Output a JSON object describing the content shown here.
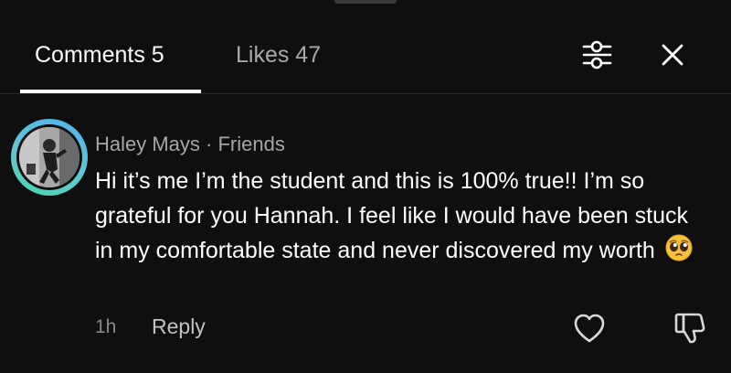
{
  "tabs": {
    "comments_label": "Comments 5",
    "likes_label": "Likes 47"
  },
  "header_icons": {
    "filter": "sliders-icon",
    "close": "close-icon"
  },
  "comment": {
    "author": "Haley Mays · Friends",
    "text": "Hi it’s me I’m the student and this is 100% true!! I’m so grateful for you Hannah. I feel like I would have been stuck in my comfortable state and never discovered my worth",
    "emoji": "pleading-face",
    "time": "1h",
    "reply_label": "Reply",
    "like_icon": "heart-icon",
    "dislike_icon": "thumbs-down-icon",
    "avatar_ring_colors": [
      "#4fb2ef",
      "#4ad6b1"
    ]
  }
}
